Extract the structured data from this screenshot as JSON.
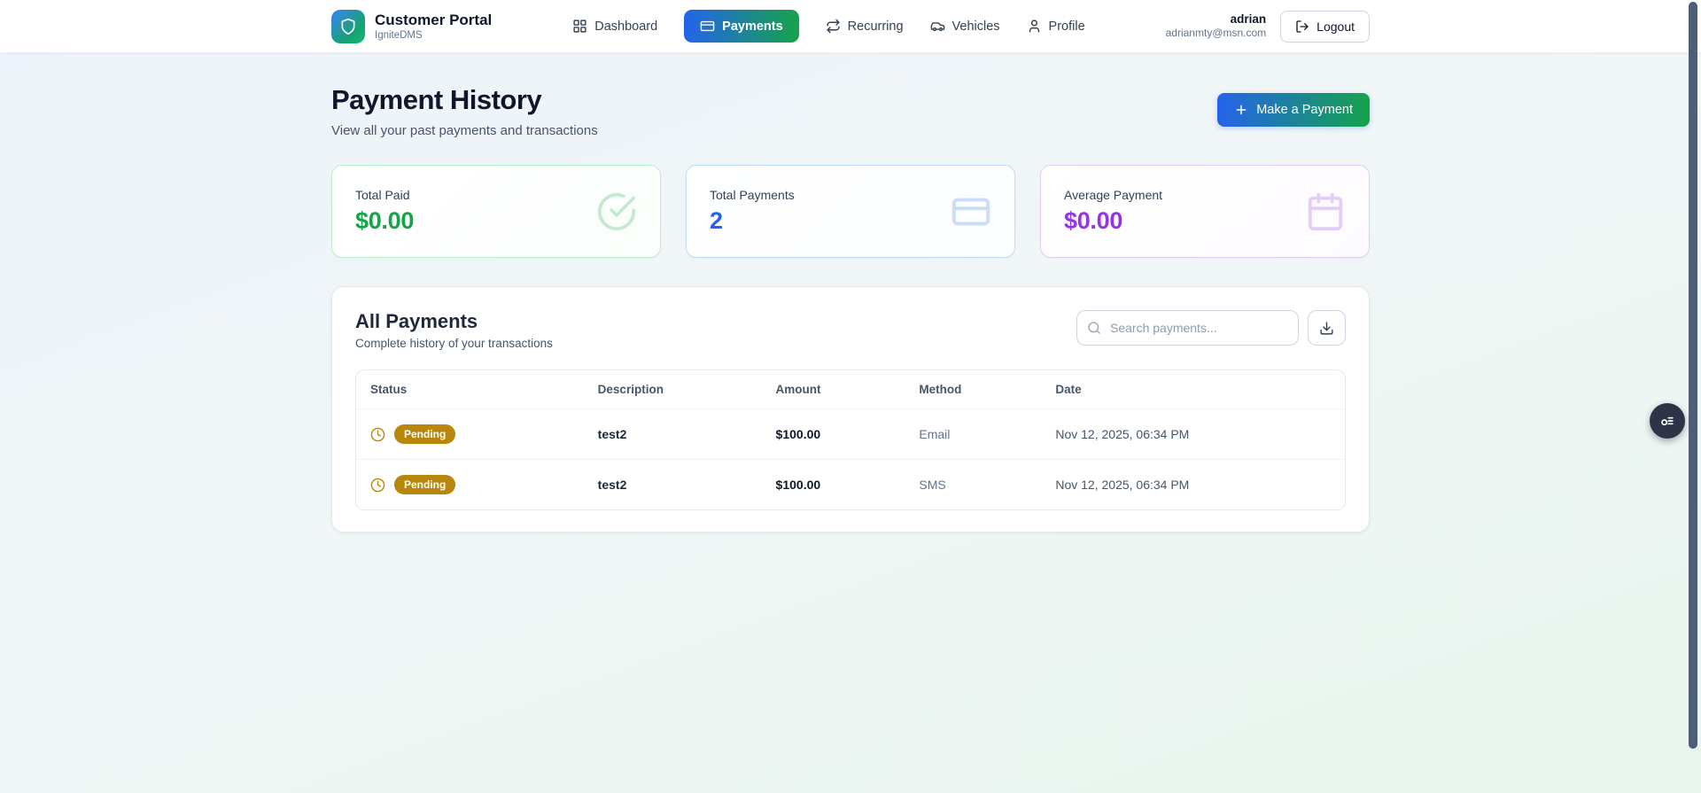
{
  "colors": {
    "brand_gradient_start": "#3b82f6",
    "brand_gradient_end": "#10b981",
    "nav_active_gradient_start": "#2563eb",
    "nav_active_gradient_end": "#16a34a",
    "total_paid_accent": "#16a34a",
    "total_payments_accent": "#2563eb",
    "average_payment_accent": "#9333ea",
    "pending_badge": "#b8860b",
    "scrollbar_thumb": "#4d5e78"
  },
  "header": {
    "brand_title": "Customer Portal",
    "brand_subtitle": "IgniteDMS",
    "nav": [
      {
        "label": "Dashboard",
        "icon": "grid-icon"
      },
      {
        "label": "Payments",
        "icon": "credit-card-icon",
        "active": true
      },
      {
        "label": "Recurring",
        "icon": "repeat-icon"
      },
      {
        "label": "Vehicles",
        "icon": "car-icon"
      },
      {
        "label": "Profile",
        "icon": "user-icon"
      }
    ],
    "user": {
      "name": "adrian",
      "email": "adrianmty@msn.com"
    },
    "logout_label": "Logout"
  },
  "page": {
    "title": "Payment History",
    "subtitle": "View all your past payments and transactions",
    "make_payment_label": "Make a Payment"
  },
  "stats": [
    {
      "label": "Total Paid",
      "value": "$0.00",
      "icon": "check-circle-icon"
    },
    {
      "label": "Total Payments",
      "value": "2",
      "icon": "credit-card-icon"
    },
    {
      "label": "Average Payment",
      "value": "$0.00",
      "icon": "calendar-icon"
    }
  ],
  "payments_panel": {
    "title": "All Payments",
    "subtitle": "Complete history of your transactions",
    "search_placeholder": "Search payments...",
    "columns": [
      "Status",
      "Description",
      "Amount",
      "Method",
      "Date"
    ],
    "rows": [
      {
        "status": "Pending",
        "description": "test2",
        "amount": "$100.00",
        "method": "Email",
        "date": "Nov 12, 2025, 06:34 PM"
      },
      {
        "status": "Pending",
        "description": "test2",
        "amount": "$100.00",
        "method": "SMS",
        "date": "Nov 12, 2025, 06:34 PM"
      }
    ]
  }
}
